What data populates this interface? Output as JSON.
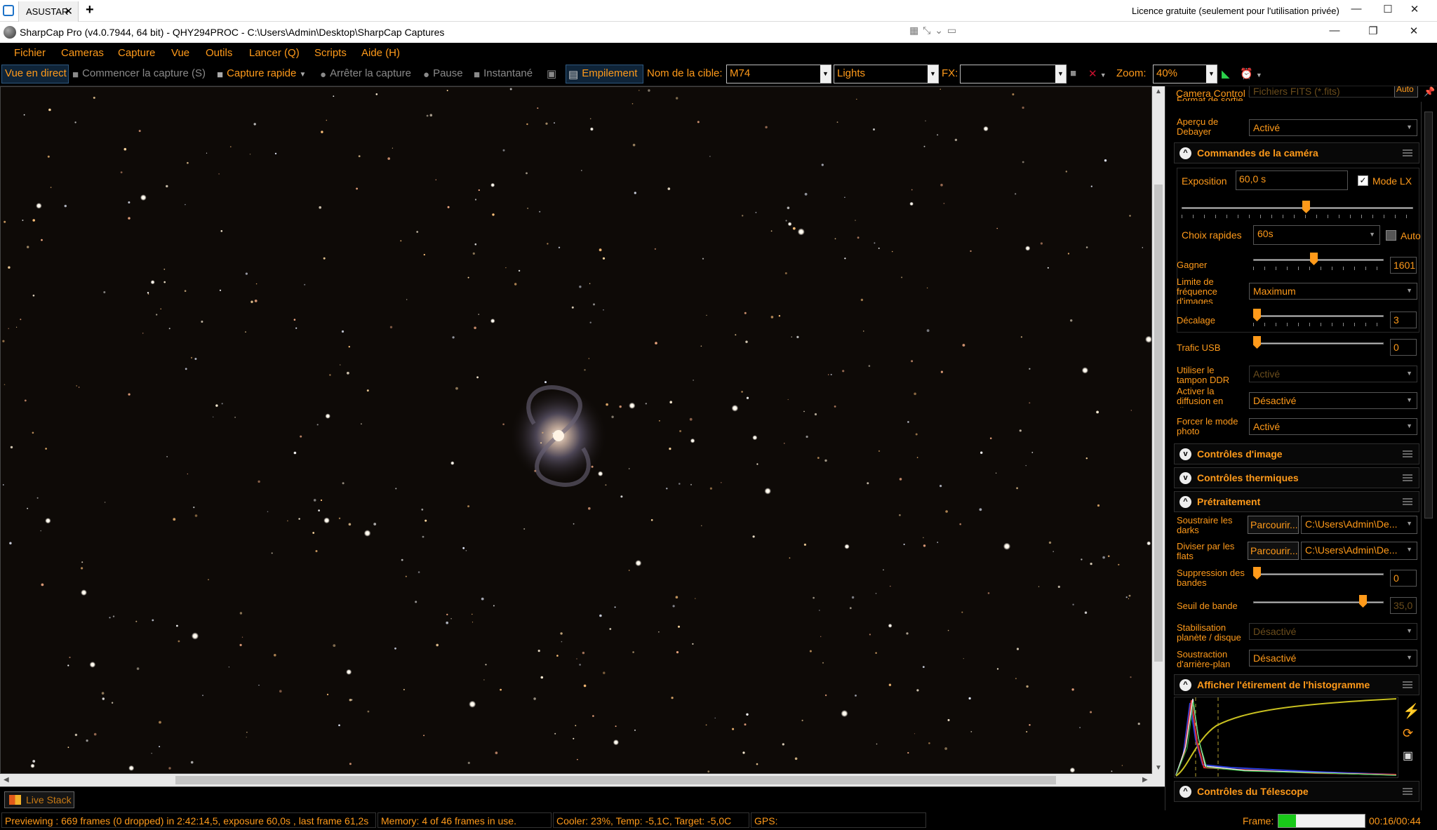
{
  "remote": {
    "tab_label": "ASUSTAR",
    "tab_close": "✕",
    "new_tab": "+",
    "licence": "Licence gratuite (seulement pour l'utilisation privée)"
  },
  "window": {
    "title": "SharpCap Pro (v4.0.7944, 64 bit) - QHY294PROC - C:\\Users\\Admin\\Desktop\\SharpCap Captures",
    "minimize": "—",
    "maximize": "☐",
    "restore": "❐",
    "close": "✕"
  },
  "menu": [
    "Fichier",
    "Cameras",
    "Capture",
    "Vue",
    "Outils",
    "Lancer (Q)",
    "Scripts",
    "Aide (H)"
  ],
  "toolbar": {
    "live_view": "Vue en direct",
    "start_capture": "Commencer la capture (S)",
    "quick_capture": "Capture rapide",
    "stop_capture": "Arrêter la capture",
    "pause": "Pause",
    "snapshot": "Instantané",
    "stacking": "Empilement",
    "target_label": "Nom de la cible:",
    "target_value": "M74",
    "frame_type": "Lights",
    "fx_label": "FX:",
    "fx_value": "",
    "zoom_label": "Zoom:",
    "zoom_value": "40%"
  },
  "bottom": {
    "live_stack_tab": "Live Stack"
  },
  "status": {
    "previewing": "Previewing : 669 frames (0 dropped) in 2:42:14,5, exposure 60,0s , last frame 61,2s",
    "memory": "Memory: 4 of 46 frames in use.",
    "cooler": "Cooler: 23%, Temp: -5,1C, Target: -5,0C",
    "gps": "GPS:",
    "frame_label": "Frame:",
    "frame_progress": 0.2,
    "elapsed": "00:16/00:44"
  },
  "panel": {
    "title": "Camera Control Panel",
    "output_format_label": "Format de sortie",
    "output_format_value": "Fichiers FITS (*.fits)",
    "output_format_auto": "Auto",
    "debayer_label": "Aperçu de Debayer",
    "debayer_value": "Activé",
    "camera_controls": {
      "title": "Commandes de la caméra",
      "exposure_label": "Exposition",
      "exposure_value": "60,0 s",
      "lx_mode_label": "Mode LX",
      "exposure_slider": 0.54,
      "quick_choice_label": "Choix rapides",
      "quick_choice_value": "60s",
      "auto_label": "Auto",
      "gain_label": "Gagner",
      "gain_value": "1601",
      "gain_slider": 0.46,
      "frame_rate_label": "Limite de fréquence d'images",
      "frame_rate_value": "Maximum",
      "offset_label": "Décalage",
      "offset_value": "3",
      "offset_slider": 0.0,
      "usb_label": "Trafic USB",
      "usb_value": "0",
      "usb_slider": 0.0,
      "ddr_label": "Utiliser le tampon DDR",
      "ddr_value": "Activé",
      "live_label": "Activer la diffusion en direct",
      "live_value": "Désactivé",
      "photo_label": "Forcer le mode photo",
      "photo_value": "Activé"
    },
    "image_controls_title": "Contrôles d'image",
    "thermal_controls_title": "Contrôles thermiques",
    "preprocessing": {
      "title": "Prétraitement",
      "darks_label": "Soustraire les darks",
      "darks_browse": "Parcourir...",
      "darks_path": "C:\\Users\\Admin\\De...",
      "flats_label": "Diviser par les flats",
      "flats_browse": "Parcourir...",
      "flats_path": "C:\\Users\\Admin\\De...",
      "banding_label": "Suppression des bandes",
      "banding_value": "0",
      "banding_slider": 0.0,
      "band_threshold_label": "Seuil de bande",
      "band_threshold_value": "35,0",
      "band_threshold_slider": 0.86,
      "stabilization_label": "Stabilisation planète / disque",
      "stabilization_value": "Désactivé",
      "background_label": "Soustraction d'arrière-plan",
      "background_value": "Désactivé"
    },
    "histogram_title": "Afficher l'étirement de l'histogramme",
    "telescope_title": "Contrôles du Télescope"
  },
  "colors": {
    "accent": "#ff9a1a",
    "background": "#000000",
    "frame_fill": "#19c919"
  }
}
